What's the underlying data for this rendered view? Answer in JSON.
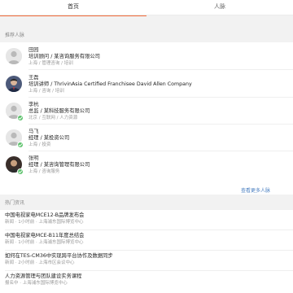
{
  "tabs": [
    {
      "label": "首页",
      "active": true
    },
    {
      "label": "人脉",
      "active": false
    }
  ],
  "colors": {
    "accent": "#f26b3a",
    "link": "#4a7fc1",
    "verified": "#5cc26b"
  },
  "people_section": {
    "title": "推荐人脉",
    "more_link": "查看更多人脉",
    "items": [
      {
        "name": "田园",
        "org": "培训顾问 / 某咨询服务有限公司",
        "tags": "上海 / 管理咨询 / 培训",
        "avatar": "default-avatar-icon",
        "verified": false
      },
      {
        "name": "王磊",
        "org": "培训讲师 / ThrivinAsia Certified Franchisee David Allen Company",
        "tags": "上海 / 咨询 / 培训",
        "avatar": "photo-avatar",
        "verified": false
      },
      {
        "name": "李杭",
        "org": "总监 / 某科技服务有限公司",
        "tags": "北京 / 互联网 / 人力资源",
        "avatar": "default-avatar-icon",
        "verified": true
      },
      {
        "name": "马飞",
        "org": "经理 / 某投资公司",
        "tags": "上海 / 投资",
        "avatar": "default-avatar-icon",
        "verified": true
      },
      {
        "name": "张明",
        "org": "经理 / 某咨询管理有限公司",
        "tags": "上海 / 咨询服务",
        "avatar": "photo-avatar-2",
        "verified": true
      }
    ]
  },
  "news_section": {
    "title": "热门资讯",
    "items": [
      {
        "title": "中国电视家电MCE12-B品牌发布会",
        "sub": "新闻 · 1小时前 · 上海浦东国际博览中心"
      },
      {
        "title": "中国电视家电MCE-B11年度总结会",
        "sub": "新闻 · 1小时前 · 上海浦东国际博览中心"
      },
      {
        "title": "如何在TES-CM36中实现跨平台协作及数据同步",
        "sub": "新闻 · 2小时前 · 上海市区会议中心"
      },
      {
        "title": "人力资源管理与团队建设实务课程",
        "sub": "报名中 · 上海浦东国际博览中心"
      }
    ]
  }
}
